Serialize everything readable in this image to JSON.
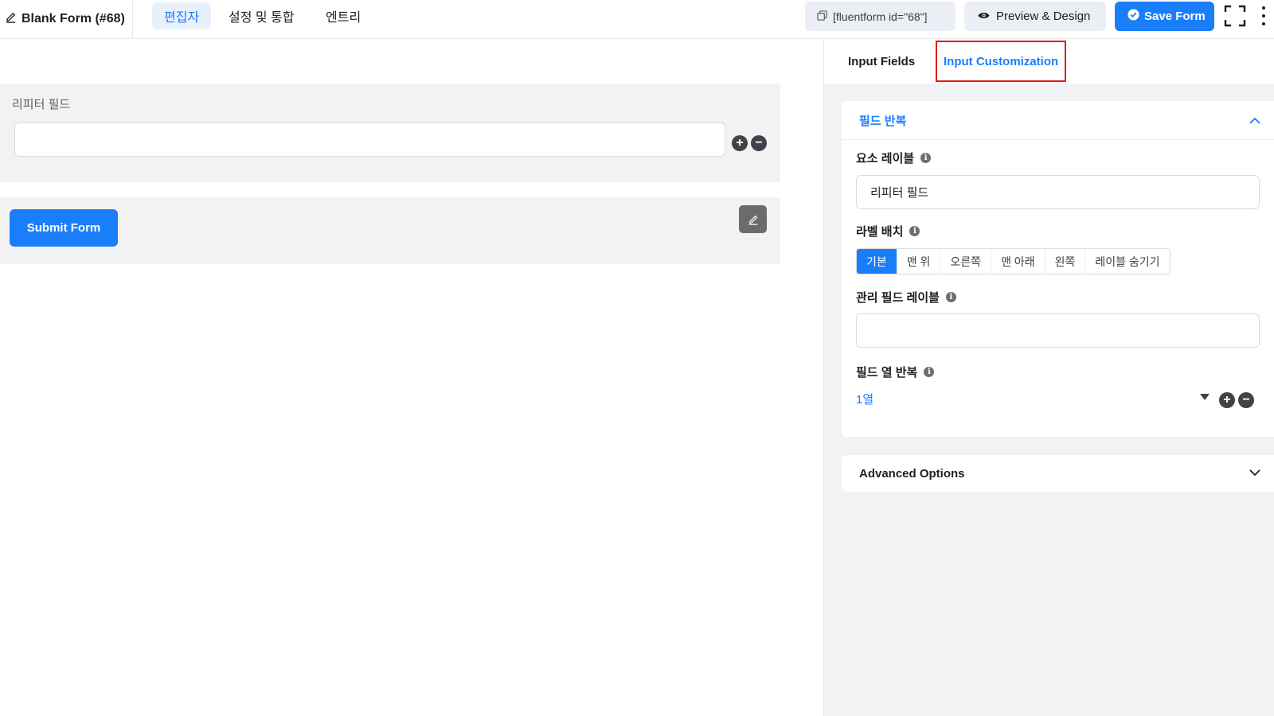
{
  "header": {
    "form_title": "Blank Form (#68)",
    "tabs": [
      "편집자",
      "설정 및 통합",
      "엔트리"
    ],
    "active_tab": "편집자",
    "shortcode": "[fluentform id=\"68\"]",
    "preview_label": "Preview & Design",
    "save_label": "Save Form"
  },
  "canvas": {
    "repeater_label": "리피터 필드",
    "submit_label": "Submit Form"
  },
  "sidebar": {
    "tabs": [
      "Input Fields",
      "Input Customization"
    ],
    "active_tab": "Input Customization",
    "panel_title": "필드 반복",
    "element_label_title": "요소 레이블",
    "element_label_value": "리피터 필드",
    "label_placement_title": "라벨 배치",
    "label_placement_options": [
      "기본",
      "맨 위",
      "오른쪽",
      "맨 아래",
      "왼쪽",
      "레이블 숨기기"
    ],
    "label_placement_selected": "기본",
    "admin_label_title": "관리 필드 레이블",
    "admin_label_value": "",
    "repeat_columns_title": "필드 열 반복",
    "repeat_columns_value": "1열",
    "advanced_title": "Advanced Options"
  },
  "colors": {
    "accent": "#1a7efb",
    "highlight_border": "#e31b1b"
  }
}
